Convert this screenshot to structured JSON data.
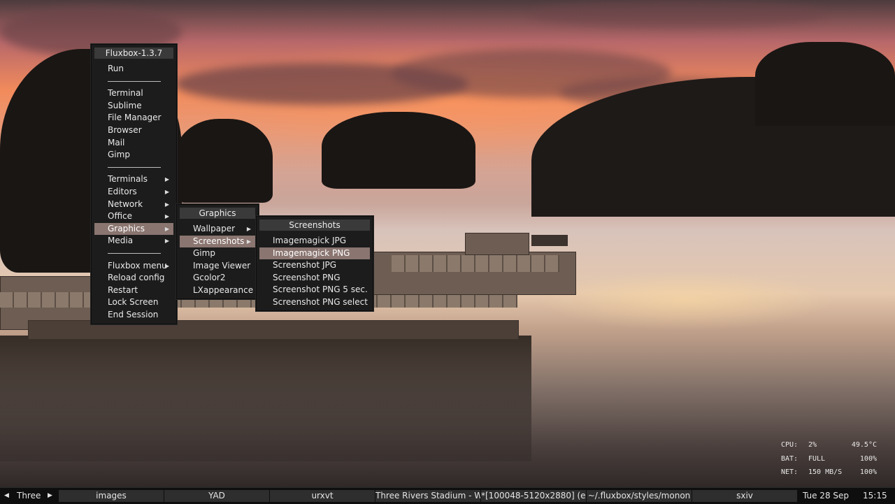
{
  "colors": {
    "menu_bg": "#1c1c1c",
    "menu_title_bg": "#3a3a3a",
    "menu_selected": "#8a7570",
    "toolbar_bg": "#0e0e0e",
    "task_bg": "#2e2e2e"
  },
  "root_menu": {
    "title": "Fluxbox-1.3.7",
    "items": [
      {
        "label": "Run"
      },
      {
        "separator": true
      },
      {
        "label": "Terminal"
      },
      {
        "label": "Sublime"
      },
      {
        "label": "File Manager"
      },
      {
        "label": "Browser"
      },
      {
        "label": "Mail"
      },
      {
        "label": "Gimp"
      },
      {
        "separator": true
      },
      {
        "label": "Terminals",
        "submenu": true
      },
      {
        "label": "Editors",
        "submenu": true
      },
      {
        "label": "Network",
        "submenu": true
      },
      {
        "label": "Office",
        "submenu": true
      },
      {
        "label": "Graphics",
        "submenu": true,
        "selected": true
      },
      {
        "label": "Media",
        "submenu": true
      },
      {
        "separator": true
      },
      {
        "label": "Fluxbox menu",
        "submenu": true
      },
      {
        "label": "Reload config"
      },
      {
        "label": "Restart"
      },
      {
        "label": "Lock Screen"
      },
      {
        "label": "End Session"
      }
    ]
  },
  "graphics_menu": {
    "title": "Graphics",
    "items": [
      {
        "label": "Wallpaper",
        "submenu": true
      },
      {
        "label": "Screenshots",
        "submenu": true,
        "selected": true
      },
      {
        "label": "Gimp"
      },
      {
        "label": "Image Viewer"
      },
      {
        "label": "Gcolor2"
      },
      {
        "label": "LXappearance"
      }
    ]
  },
  "screenshots_menu": {
    "title": "Screenshots",
    "items": [
      {
        "label": "Imagemagick JPG"
      },
      {
        "label": "Imagemagick PNG",
        "selected": true
      },
      {
        "label": "Screenshot JPG"
      },
      {
        "label": "Screenshot PNG"
      },
      {
        "label": "Screenshot PNG 5 sec."
      },
      {
        "label": "Screenshot PNG select"
      }
    ]
  },
  "toolbar": {
    "workspace": {
      "prev_icon": "triangle-left-icon",
      "name": "Three",
      "next_icon": "triangle-right-icon",
      "prev_glyph": "◀",
      "next_glyph": "▶"
    },
    "tasks": [
      "images",
      "YAD",
      "urxvt",
      "Three Rivers Stadium - Wi",
      "*[100048-5120x2880] (exp",
      "~/.fluxbox/styles/monon",
      "sxiv"
    ],
    "date": "Tue 28 Sep",
    "time": "15:15"
  },
  "stats": [
    {
      "label": "CPU:",
      "value": "2%",
      "extra": "49.5°C"
    },
    {
      "label": "BAT:",
      "value": "FULL",
      "extra": "100%"
    },
    {
      "label": "NET:",
      "value": "150 MB/S",
      "extra": "100%"
    }
  ],
  "submenu_arrow_icon": "triangle-right-icon",
  "submenu_arrow_glyph": "▶"
}
